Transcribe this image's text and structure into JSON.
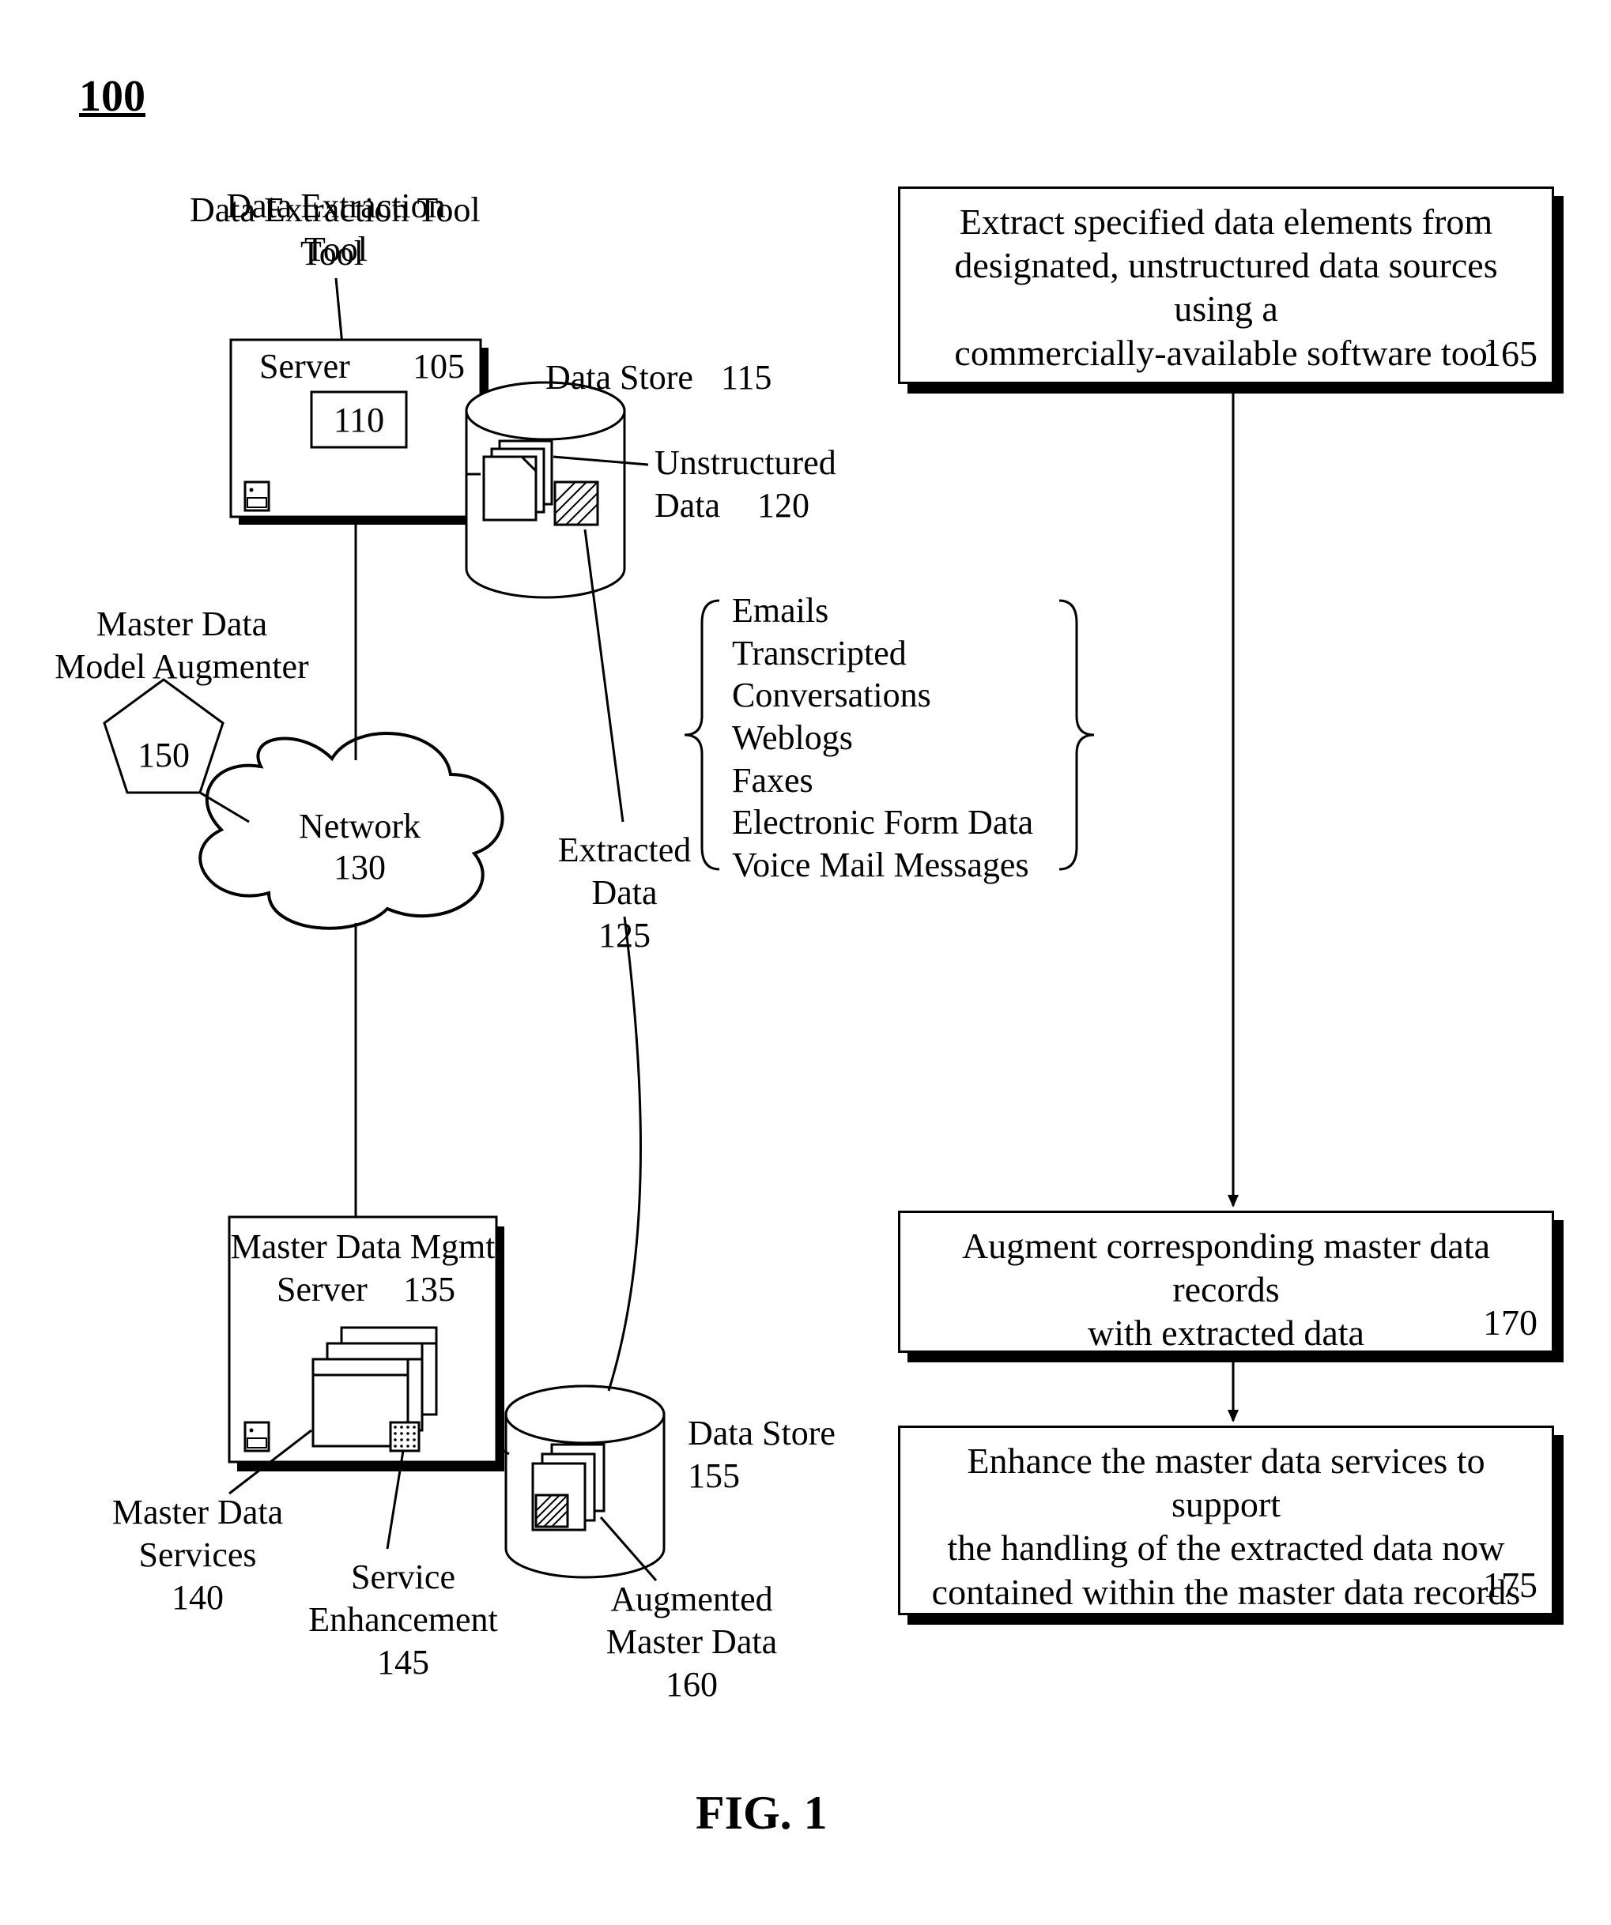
{
  "figure": {
    "number": "100",
    "caption": "FIG. 1"
  },
  "labels": {
    "data_extraction_tool": "Data Extraction Tool",
    "server_top": {
      "title": "Server",
      "num": "105",
      "inner_num": "110"
    },
    "data_store_top": {
      "title": "Data Store",
      "num": "115"
    },
    "unstructured_data": {
      "title": "Unstructured",
      "line2": "Data",
      "num": "120"
    },
    "extracted_data": {
      "title": "Extracted",
      "line2": "Data",
      "num": "125"
    },
    "network": {
      "title": "Network",
      "num": "130"
    },
    "mdm_server": {
      "title": "Master Data Mgmt",
      "line2": "Server",
      "num": "135"
    },
    "master_data_services": {
      "title": "Master Data",
      "line2": "Services",
      "num": "140"
    },
    "service_enhancement": {
      "title": "Service",
      "line2": "Enhancement",
      "num": "145"
    },
    "master_data_model_augmenter": {
      "title": "Master Data",
      "line2": "Model Augmenter",
      "num": "150"
    },
    "data_store_bottom": {
      "title": "Data Store",
      "num": "155"
    },
    "augmented_master_data": {
      "title": "Augmented",
      "line2": "Master Data",
      "num": "160"
    }
  },
  "unstructured_examples": [
    "Emails",
    "Transcripted",
    "Conversations",
    "Weblogs",
    "Faxes",
    "Electronic Form Data",
    "Voice Mail Messages"
  ],
  "flow": {
    "step1": {
      "text_l1": "Extract specified data elements from",
      "text_l2": "designated, unstructured data sources using a",
      "text_l3": "commercially-available software tool",
      "num": "165"
    },
    "step2": {
      "text_l1": "Augment corresponding master data records",
      "text_l2": "with extracted data",
      "num": "170"
    },
    "step3": {
      "text_l1": "Enhance the master data services to support",
      "text_l2": "the handling of the extracted data now",
      "text_l3": "contained within the master data records",
      "num": "175"
    }
  }
}
